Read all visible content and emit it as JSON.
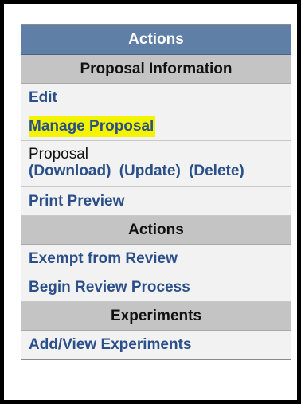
{
  "panel": {
    "title": "Actions",
    "sections": {
      "proposal_information": {
        "header": "Proposal Information",
        "edit": "Edit",
        "manage_proposal": "Manage Proposal",
        "proposal_label": "Proposal",
        "download": "(Download)",
        "update": "(Update)",
        "delete": "(Delete)",
        "print_preview": "Print Preview"
      },
      "actions": {
        "header": "Actions",
        "exempt_from_review": "Exempt from Review",
        "begin_review_process": "Begin Review Process"
      },
      "experiments": {
        "header": "Experiments",
        "add_view_experiments": "Add/View Experiments"
      }
    }
  },
  "colors": {
    "title_bar": "#5f7fa6",
    "section_header": "#c4c4c4",
    "link": "#2b4f88",
    "highlight": "#f4f400",
    "frame_border": "#000000"
  }
}
